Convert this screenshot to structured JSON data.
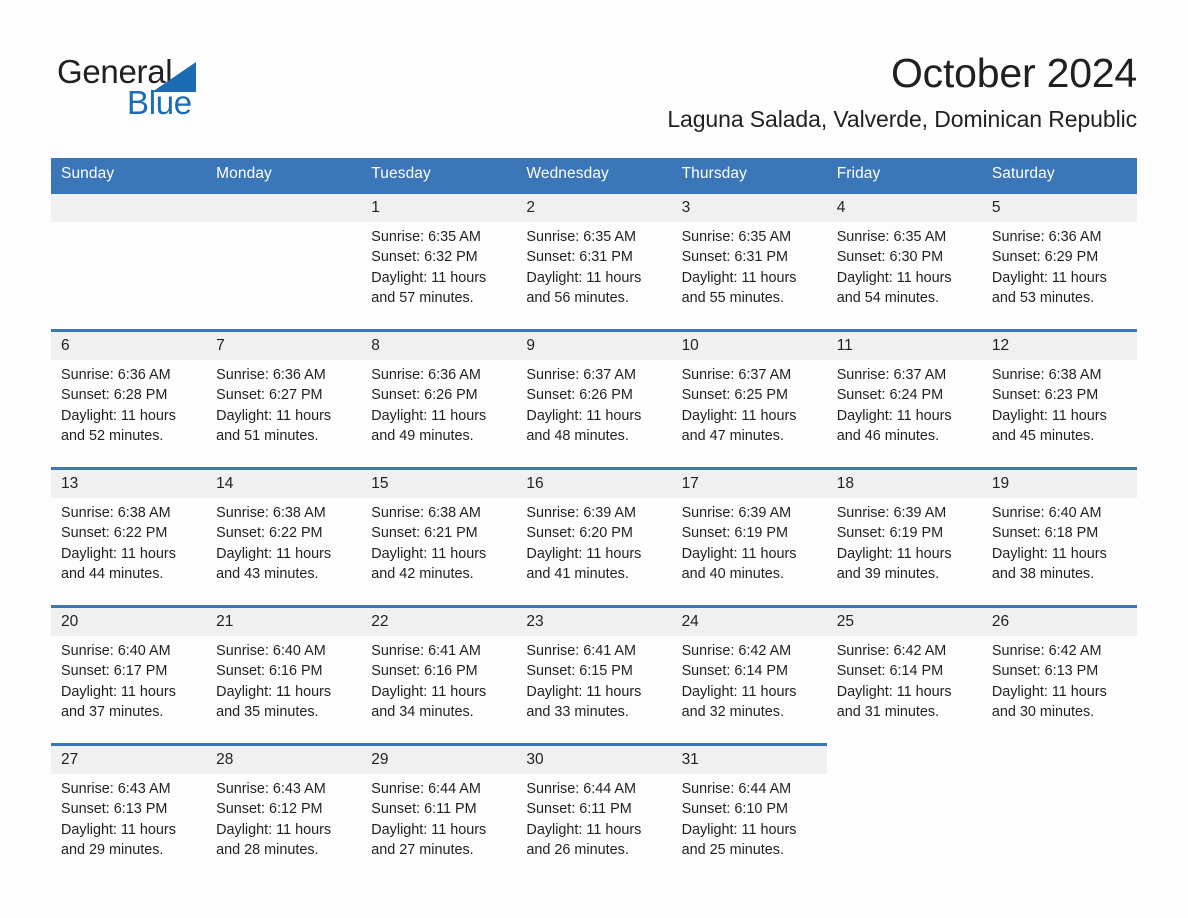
{
  "logo": {
    "word_one": "General",
    "word_two": "Blue",
    "triangle_color": "#1b6cb5",
    "blue_text_color": "#1a6cb4"
  },
  "header": {
    "month_title": "October 2024",
    "location": "Laguna Salada, Valverde, Dominican Republic"
  },
  "theme": {
    "header_row_color": "#3a76b8",
    "date_band_color": "#f0f0f0",
    "page_background": "#fdfdfd",
    "text_color": "#231f20"
  },
  "weekday_headers": [
    "Sunday",
    "Monday",
    "Tuesday",
    "Wednesday",
    "Thursday",
    "Friday",
    "Saturday"
  ],
  "weeks": [
    [
      {
        "date": "",
        "empty": true,
        "sunrise": "",
        "sunset": "",
        "daylight_line1": "",
        "daylight_line2": ""
      },
      {
        "date": "",
        "empty": true,
        "sunrise": "",
        "sunset": "",
        "daylight_line1": "",
        "daylight_line2": ""
      },
      {
        "date": "1",
        "sunrise": "Sunrise: 6:35 AM",
        "sunset": "Sunset: 6:32 PM",
        "daylight_line1": "Daylight: 11 hours",
        "daylight_line2": "and 57 minutes."
      },
      {
        "date": "2",
        "sunrise": "Sunrise: 6:35 AM",
        "sunset": "Sunset: 6:31 PM",
        "daylight_line1": "Daylight: 11 hours",
        "daylight_line2": "and 56 minutes."
      },
      {
        "date": "3",
        "sunrise": "Sunrise: 6:35 AM",
        "sunset": "Sunset: 6:31 PM",
        "daylight_line1": "Daylight: 11 hours",
        "daylight_line2": "and 55 minutes."
      },
      {
        "date": "4",
        "sunrise": "Sunrise: 6:35 AM",
        "sunset": "Sunset: 6:30 PM",
        "daylight_line1": "Daylight: 11 hours",
        "daylight_line2": "and 54 minutes."
      },
      {
        "date": "5",
        "sunrise": "Sunrise: 6:36 AM",
        "sunset": "Sunset: 6:29 PM",
        "daylight_line1": "Daylight: 11 hours",
        "daylight_line2": "and 53 minutes."
      }
    ],
    [
      {
        "date": "6",
        "sunrise": "Sunrise: 6:36 AM",
        "sunset": "Sunset: 6:28 PM",
        "daylight_line1": "Daylight: 11 hours",
        "daylight_line2": "and 52 minutes."
      },
      {
        "date": "7",
        "sunrise": "Sunrise: 6:36 AM",
        "sunset": "Sunset: 6:27 PM",
        "daylight_line1": "Daylight: 11 hours",
        "daylight_line2": "and 51 minutes."
      },
      {
        "date": "8",
        "sunrise": "Sunrise: 6:36 AM",
        "sunset": "Sunset: 6:26 PM",
        "daylight_line1": "Daylight: 11 hours",
        "daylight_line2": "and 49 minutes."
      },
      {
        "date": "9",
        "sunrise": "Sunrise: 6:37 AM",
        "sunset": "Sunset: 6:26 PM",
        "daylight_line1": "Daylight: 11 hours",
        "daylight_line2": "and 48 minutes."
      },
      {
        "date": "10",
        "sunrise": "Sunrise: 6:37 AM",
        "sunset": "Sunset: 6:25 PM",
        "daylight_line1": "Daylight: 11 hours",
        "daylight_line2": "and 47 minutes."
      },
      {
        "date": "11",
        "sunrise": "Sunrise: 6:37 AM",
        "sunset": "Sunset: 6:24 PM",
        "daylight_line1": "Daylight: 11 hours",
        "daylight_line2": "and 46 minutes."
      },
      {
        "date": "12",
        "sunrise": "Sunrise: 6:38 AM",
        "sunset": "Sunset: 6:23 PM",
        "daylight_line1": "Daylight: 11 hours",
        "daylight_line2": "and 45 minutes."
      }
    ],
    [
      {
        "date": "13",
        "sunrise": "Sunrise: 6:38 AM",
        "sunset": "Sunset: 6:22 PM",
        "daylight_line1": "Daylight: 11 hours",
        "daylight_line2": "and 44 minutes."
      },
      {
        "date": "14",
        "sunrise": "Sunrise: 6:38 AM",
        "sunset": "Sunset: 6:22 PM",
        "daylight_line1": "Daylight: 11 hours",
        "daylight_line2": "and 43 minutes."
      },
      {
        "date": "15",
        "sunrise": "Sunrise: 6:38 AM",
        "sunset": "Sunset: 6:21 PM",
        "daylight_line1": "Daylight: 11 hours",
        "daylight_line2": "and 42 minutes."
      },
      {
        "date": "16",
        "sunrise": "Sunrise: 6:39 AM",
        "sunset": "Sunset: 6:20 PM",
        "daylight_line1": "Daylight: 11 hours",
        "daylight_line2": "and 41 minutes."
      },
      {
        "date": "17",
        "sunrise": "Sunrise: 6:39 AM",
        "sunset": "Sunset: 6:19 PM",
        "daylight_line1": "Daylight: 11 hours",
        "daylight_line2": "and 40 minutes."
      },
      {
        "date": "18",
        "sunrise": "Sunrise: 6:39 AM",
        "sunset": "Sunset: 6:19 PM",
        "daylight_line1": "Daylight: 11 hours",
        "daylight_line2": "and 39 minutes."
      },
      {
        "date": "19",
        "sunrise": "Sunrise: 6:40 AM",
        "sunset": "Sunset: 6:18 PM",
        "daylight_line1": "Daylight: 11 hours",
        "daylight_line2": "and 38 minutes."
      }
    ],
    [
      {
        "date": "20",
        "sunrise": "Sunrise: 6:40 AM",
        "sunset": "Sunset: 6:17 PM",
        "daylight_line1": "Daylight: 11 hours",
        "daylight_line2": "and 37 minutes."
      },
      {
        "date": "21",
        "sunrise": "Sunrise: 6:40 AM",
        "sunset": "Sunset: 6:16 PM",
        "daylight_line1": "Daylight: 11 hours",
        "daylight_line2": "and 35 minutes."
      },
      {
        "date": "22",
        "sunrise": "Sunrise: 6:41 AM",
        "sunset": "Sunset: 6:16 PM",
        "daylight_line1": "Daylight: 11 hours",
        "daylight_line2": "and 34 minutes."
      },
      {
        "date": "23",
        "sunrise": "Sunrise: 6:41 AM",
        "sunset": "Sunset: 6:15 PM",
        "daylight_line1": "Daylight: 11 hours",
        "daylight_line2": "and 33 minutes."
      },
      {
        "date": "24",
        "sunrise": "Sunrise: 6:42 AM",
        "sunset": "Sunset: 6:14 PM",
        "daylight_line1": "Daylight: 11 hours",
        "daylight_line2": "and 32 minutes."
      },
      {
        "date": "25",
        "sunrise": "Sunrise: 6:42 AM",
        "sunset": "Sunset: 6:14 PM",
        "daylight_line1": "Daylight: 11 hours",
        "daylight_line2": "and 31 minutes."
      },
      {
        "date": "26",
        "sunrise": "Sunrise: 6:42 AM",
        "sunset": "Sunset: 6:13 PM",
        "daylight_line1": "Daylight: 11 hours",
        "daylight_line2": "and 30 minutes."
      }
    ],
    [
      {
        "date": "27",
        "sunrise": "Sunrise: 6:43 AM",
        "sunset": "Sunset: 6:13 PM",
        "daylight_line1": "Daylight: 11 hours",
        "daylight_line2": "and 29 minutes."
      },
      {
        "date": "28",
        "sunrise": "Sunrise: 6:43 AM",
        "sunset": "Sunset: 6:12 PM",
        "daylight_line1": "Daylight: 11 hours",
        "daylight_line2": "and 28 minutes."
      },
      {
        "date": "29",
        "sunrise": "Sunrise: 6:44 AM",
        "sunset": "Sunset: 6:11 PM",
        "daylight_line1": "Daylight: 11 hours",
        "daylight_line2": "and 27 minutes."
      },
      {
        "date": "30",
        "sunrise": "Sunrise: 6:44 AM",
        "sunset": "Sunset: 6:11 PM",
        "daylight_line1": "Daylight: 11 hours",
        "daylight_line2": "and 26 minutes."
      },
      {
        "date": "31",
        "sunrise": "Sunrise: 6:44 AM",
        "sunset": "Sunset: 6:10 PM",
        "daylight_line1": "Daylight: 11 hours",
        "daylight_line2": "and 25 minutes."
      },
      {
        "date": "",
        "empty": true,
        "trailing": true,
        "sunrise": "",
        "sunset": "",
        "daylight_line1": "",
        "daylight_line2": ""
      },
      {
        "date": "",
        "empty": true,
        "trailing": true,
        "sunrise": "",
        "sunset": "",
        "daylight_line1": "",
        "daylight_line2": ""
      }
    ]
  ]
}
